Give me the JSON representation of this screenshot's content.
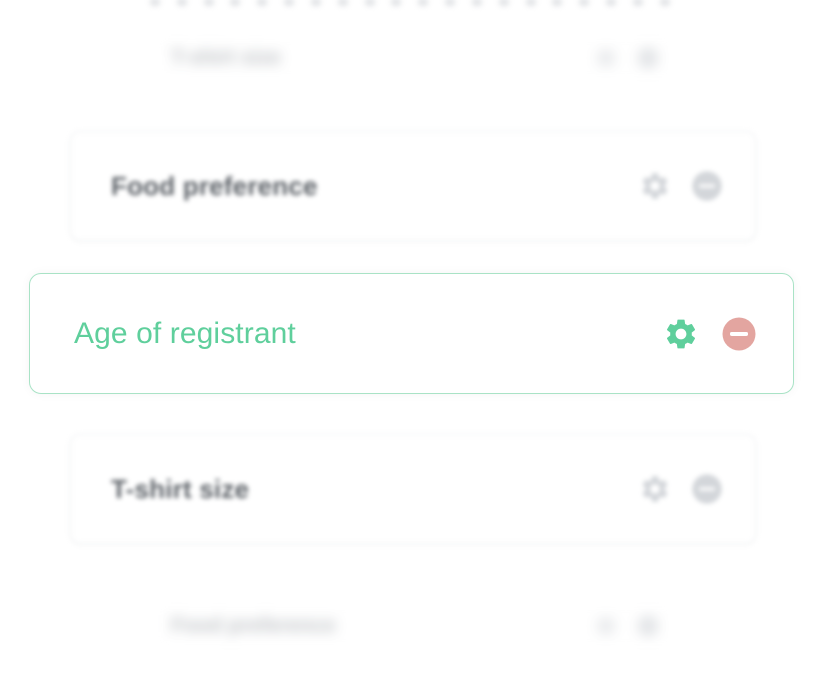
{
  "fields": {
    "top_far": {
      "label": "T-shirt size"
    },
    "food": {
      "label": "Food preference"
    },
    "age": {
      "label": "Age of registrant"
    },
    "tshirt": {
      "label": "T-shirt size"
    },
    "bottom_far": {
      "label": "Food preference"
    }
  },
  "icons": {
    "settings": "gear-icon",
    "remove": "minus-circle-icon"
  },
  "colors": {
    "accent_green": "#5fcf9c",
    "focus_border": "#a9e3c6",
    "remove_red": "#e3a5a0",
    "muted_icon": "#d3d6da",
    "muted_text": "#5d6268",
    "background": "#ffffff"
  }
}
